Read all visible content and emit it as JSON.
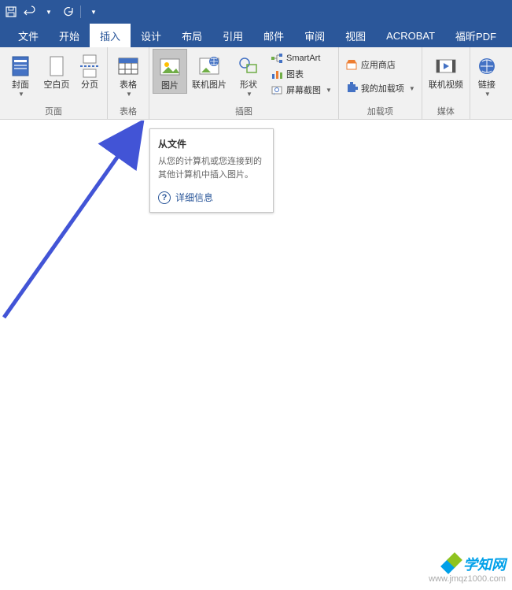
{
  "qat": {
    "save": "保存",
    "undo": "撤销",
    "redo": "重做"
  },
  "tabs": {
    "file": "文件",
    "home": "开始",
    "insert": "插入",
    "design": "设计",
    "layout": "布局",
    "references": "引用",
    "mailings": "邮件",
    "review": "审阅",
    "view": "视图",
    "acrobat": "ACROBAT",
    "foxit": "福昕PDF"
  },
  "ribbon": {
    "page_group": {
      "label": "页面",
      "cover": "封面",
      "blank": "空白页",
      "break": "分页"
    },
    "table_group": {
      "label": "表格",
      "table": "表格"
    },
    "illustration_group": {
      "label": "插图",
      "picture": "图片",
      "online_pic": "联机图片",
      "shapes": "形状",
      "smartart": "SmartArt",
      "chart": "图表",
      "screenshot": "屏幕截图"
    },
    "addin_group": {
      "label": "加载项",
      "store": "应用商店",
      "my_addins": "我的加载项"
    },
    "media_group": {
      "label": "媒体",
      "video": "联机视频"
    },
    "link_group": {
      "label": "",
      "link": "链接"
    }
  },
  "tooltip": {
    "title": "从文件",
    "body": "从您的计算机或您连接到的其他计算机中插入图片。",
    "more": "详细信息"
  },
  "watermark": {
    "brand": "学知网",
    "url": "www.jmqz1000.com"
  }
}
